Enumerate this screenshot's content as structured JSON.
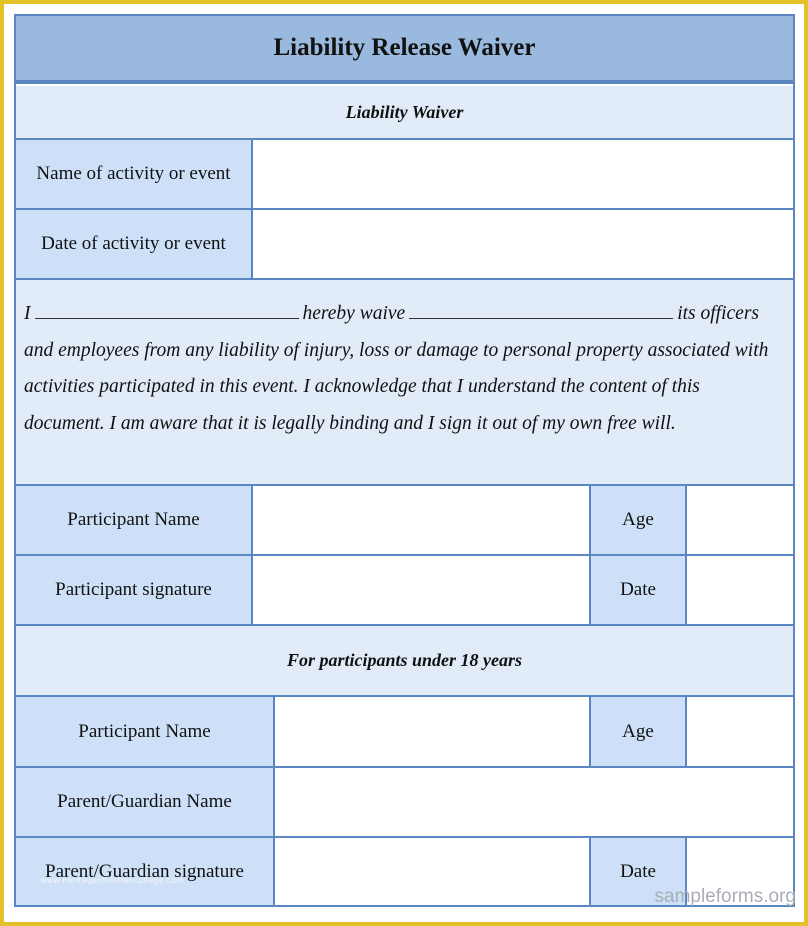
{
  "title": "Liability Release Waiver",
  "section_header": "Liability Waiver",
  "event_fields": [
    {
      "label": "Name of activity or event",
      "value": ""
    },
    {
      "label": "Date of activity or event",
      "value": ""
    }
  ],
  "waiver_text": {
    "prefix": "I",
    "middle": "hereby waive",
    "suffix": "its officers",
    "body": "and employees from any liability of injury, loss or damage to personal property associated with activities participated in this event. I acknowledge that I understand the content of this document. I am aware that it is legally binding and I sign it out of my own free will."
  },
  "participant": {
    "name_label": "Participant Name",
    "name_value": "",
    "age_label": "Age",
    "age_value": "",
    "signature_label": "Participant signature",
    "signature_value": "",
    "date_label": "Date",
    "date_value": ""
  },
  "minor_section_header": "For participants under 18 years",
  "minor": {
    "name_label": "Participant Name",
    "name_value": "",
    "age_label": "Age",
    "age_value": "",
    "guardian_name_label": "Parent/Guardian Name",
    "guardian_name_value": "",
    "guardian_signature_label": "Parent/Guardian signature",
    "guardian_signature_value": "",
    "date_label": "Date",
    "date_value": ""
  },
  "watermarks": {
    "inner": "www.heritagechristiancollege.com",
    "corner": "sampleforms.org"
  },
  "colors": {
    "frame": "#e2c226",
    "title_bg": "#9ab9df",
    "label_bg": "#cde0f7",
    "section_bg": "#e1ecf8",
    "border": "#5b86c4"
  }
}
